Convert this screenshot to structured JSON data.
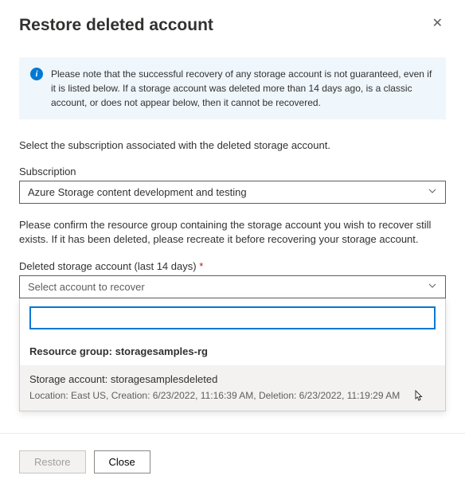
{
  "header": {
    "title": "Restore deleted account"
  },
  "info": {
    "text": "Please note that the successful recovery of any storage account is not guaranteed, even if it is listed below. If a storage account was deleted more than 14 days ago, is a classic account, or does not appear below, then it cannot be recovered."
  },
  "instruction1": "Select the subscription associated with the deleted storage account.",
  "subscription": {
    "label": "Subscription",
    "value": "Azure Storage content development and testing"
  },
  "instruction2": "Please confirm the resource group containing the storage account you wish to recover still exists. If it has been deleted, please recreate it before recovering your storage account.",
  "deletedAccount": {
    "label": "Deleted storage account (last 14 days)",
    "required": "*",
    "placeholder": "Select account to recover"
  },
  "dropdown": {
    "groupLabel": "Resource group: storagesamples-rg",
    "option": {
      "title": "Storage account: storagesamplesdeleted",
      "details": "Location: East US, Creation: 6/23/2022, 11:16:39 AM, Deletion: 6/23/2022, 11:19:29 AM"
    }
  },
  "footer": {
    "restore": "Restore",
    "close": "Close"
  }
}
